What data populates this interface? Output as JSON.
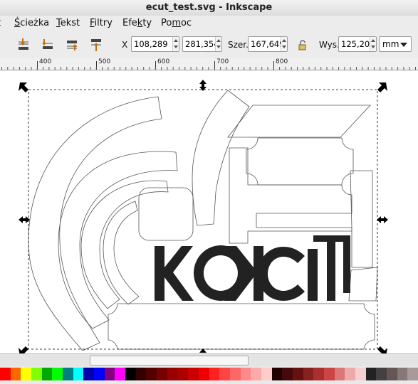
{
  "window": {
    "title": "ecut_test.svg - Inkscape"
  },
  "menu": [
    {
      "label": "Ścieżka",
      "u": "Ś"
    },
    {
      "label": "Tekst",
      "u": "T"
    },
    {
      "label": "Filtry",
      "u": "F"
    },
    {
      "label": "Efekty",
      "u": "k"
    },
    {
      "label": "Pomoc",
      "u": "m"
    }
  ],
  "toolbar": {
    "x_label": "X",
    "x_value": "108,289",
    "y_label": "Y",
    "y_value": "281,354",
    "w_label": "Szer.",
    "w_value": "167,649",
    "h_label": "Wys.",
    "h_value": "125,202",
    "unit": "mm"
  },
  "ruler": {
    "labels": [
      "400",
      "500",
      "600",
      "700",
      "800"
    ]
  },
  "canvas": {
    "logo_text": "KOKCIT"
  },
  "palette": {
    "colors": [
      "#ff0000",
      "#ff6600",
      "#ffff00",
      "#80ff00",
      "#00aa00",
      "#00ff00",
      "#008080",
      "#00ffff",
      "#0000aa",
      "#0000ff",
      "#800080",
      "#ff00ff",
      "#000000",
      "#330000",
      "#550000",
      "#770000",
      "#990000",
      "#aa0000",
      "#cc0000",
      "#ee0000",
      "#ff2020",
      "#ff4444",
      "#ff6666",
      "#ff8888",
      "#ffaaaa",
      "#ffcccc",
      "#220000",
      "#440a0a",
      "#661010",
      "#882020",
      "#aa3030",
      "#cc4444",
      "#dd7777",
      "#eeaaaa",
      "#f4d0d0",
      "#222222",
      "#444040",
      "#665555",
      "#887777",
      "#aa9999"
    ]
  }
}
